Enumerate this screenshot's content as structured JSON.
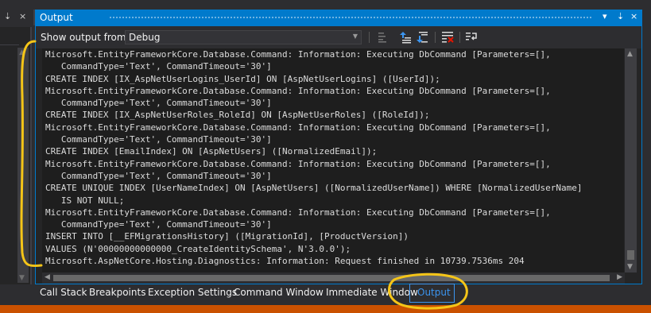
{
  "left_panel": {
    "header_glyphs": [
      "⇣",
      "×"
    ]
  },
  "output_window": {
    "title": "Output",
    "title_buttons": [
      "▾",
      "⇣",
      "×"
    ],
    "show_output_from_label": "Show output from:",
    "source_value": "Debug",
    "log_lines": [
      "Microsoft.EntityFrameworkCore.Database.Command: Information: Executing DbCommand [Parameters=[],",
      "   CommandType='Text', CommandTimeout='30']",
      "CREATE INDEX [IX_AspNetUserLogins_UserId] ON [AspNetUserLogins] ([UserId]);",
      "Microsoft.EntityFrameworkCore.Database.Command: Information: Executing DbCommand [Parameters=[],",
      "   CommandType='Text', CommandTimeout='30']",
      "CREATE INDEX [IX_AspNetUserRoles_RoleId] ON [AspNetUserRoles] ([RoleId]);",
      "Microsoft.EntityFrameworkCore.Database.Command: Information: Executing DbCommand [Parameters=[],",
      "   CommandType='Text', CommandTimeout='30']",
      "CREATE INDEX [EmailIndex] ON [AspNetUsers] ([NormalizedEmail]);",
      "Microsoft.EntityFrameworkCore.Database.Command: Information: Executing DbCommand [Parameters=[],",
      "   CommandType='Text', CommandTimeout='30']",
      "CREATE UNIQUE INDEX [UserNameIndex] ON [AspNetUsers] ([NormalizedUserName]) WHERE [NormalizedUserName]",
      "   IS NOT NULL;",
      "Microsoft.EntityFrameworkCore.Database.Command: Information: Executing DbCommand [Parameters=[],",
      "   CommandType='Text', CommandTimeout='30']",
      "INSERT INTO [__EFMigrationsHistory] ([MigrationId], [ProductVersion])",
      "VALUES (N'00000000000000_CreateIdentitySchema', N'3.0.0');",
      "Microsoft.AspNetCore.Hosting.Diagnostics: Information: Request finished in 10739.7536ms 204"
    ]
  },
  "tabs": [
    {
      "label": "Call Stack",
      "active": false
    },
    {
      "label": "Breakpoints",
      "active": false
    },
    {
      "label": "Exception Settings",
      "active": false
    },
    {
      "label": "Command Window",
      "active": false
    },
    {
      "label": "Immediate Window",
      "active": false
    },
    {
      "label": "Output",
      "active": true
    }
  ],
  "colors": {
    "accent": "#007acc",
    "active_tab_text": "#3b95f0",
    "status_bar": "#ca5100",
    "annotation": "#f5c518"
  },
  "icons": [
    "pin-icon",
    "close-icon",
    "window-menu-icon",
    "chevron-down-icon",
    "find-message-icon",
    "previous-message-icon",
    "next-message-icon",
    "clear-all-icon",
    "toggle-word-wrap-icon"
  ]
}
